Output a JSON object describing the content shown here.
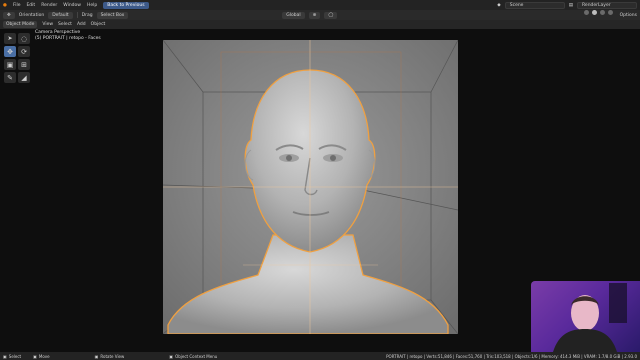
{
  "menu": {
    "items": [
      "File",
      "Edit",
      "Render",
      "Window",
      "Help"
    ],
    "back_label": "Back to Previous",
    "scene_label": "Scene",
    "layer_label": "RenderLayer"
  },
  "tool_header": {
    "orientation_label": "Orientation",
    "orientation_value": "Default",
    "drag_label": "Drag",
    "drag_value": "Select Box",
    "transform_value": "Global",
    "options_label": "Options"
  },
  "header": {
    "mode": "Object Mode",
    "menus": [
      "View",
      "Select",
      "Add",
      "Object"
    ]
  },
  "viewport": {
    "overlay_title": "Camera Perspective",
    "overlay_subtitle": "(5) PORTRAIT | retopo - Faces"
  },
  "tools": [
    {
      "icon": "cursor-icon",
      "active": false
    },
    {
      "icon": "select-circle-icon",
      "active": false
    },
    {
      "icon": "move-icon",
      "active": true
    },
    {
      "icon": "rotate-icon",
      "active": false
    },
    {
      "icon": "scale-icon",
      "active": false
    },
    {
      "icon": "transform-icon",
      "active": false
    },
    {
      "icon": "annotate-icon",
      "active": false
    },
    {
      "icon": "measure-icon",
      "active": false
    }
  ],
  "status": {
    "left": [
      "Select",
      "Move",
      "Rotate View",
      "Object Context Menu"
    ],
    "right": "PORTRAIT | retopo | Verts:51,846 | Faces:51,760 | Tris:103,518 | Objects:1/6 | Memory: 414.3 MiB | VRAM: 1.7/8.0 GiB | 2.93.0"
  },
  "colors": {
    "accent": "#4a6fa5",
    "selection_outline": "#f0a040",
    "viewport_bg": "#0e0e0e"
  }
}
